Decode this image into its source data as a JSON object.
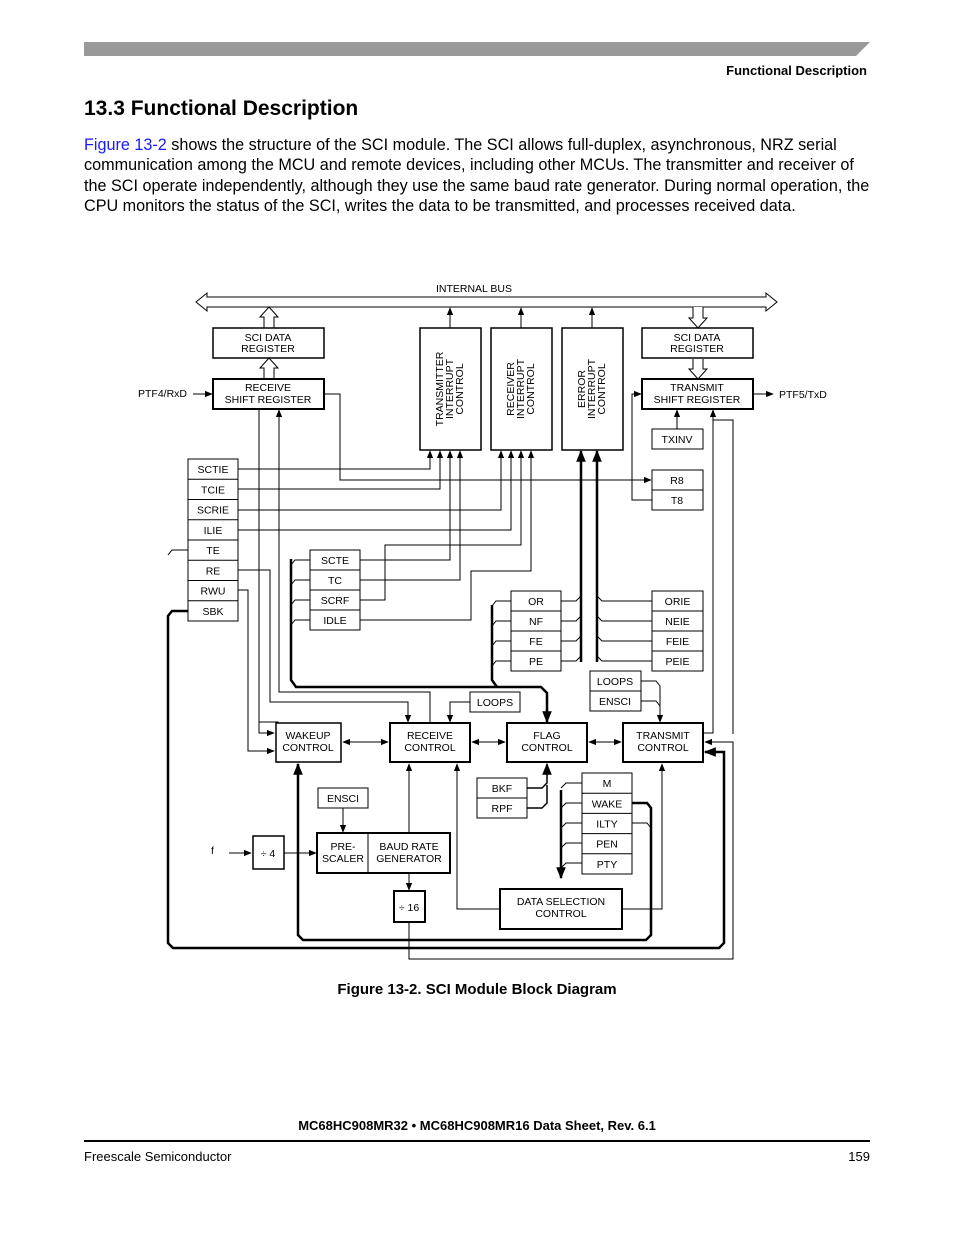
{
  "header": {
    "running_head": "Functional Description"
  },
  "section": {
    "title": "13.3  Functional Description",
    "paragraph_link": "Figure 13-2",
    "paragraph_rest": " shows the structure of the SCI module. The SCI allows full-duplex, asynchronous, NRZ serial communication among the MCU and remote devices, including other MCUs. The transmitter and receiver of the SCI operate independently, although they use the same baud rate generator. During normal operation, the CPU monitors the status of the SCI, writes the data to be transmitted, and processes received data."
  },
  "diagram": {
    "internal_bus": "INTERNAL BUS",
    "sci_data_register_rx": [
      "SCI DATA",
      "REGISTER"
    ],
    "sci_data_register_tx": [
      "SCI DATA",
      "REGISTER"
    ],
    "receive_shift_register": [
      "RECEIVE",
      "SHIFT REGISTER"
    ],
    "transmit_shift_register": [
      "TRANSMIT",
      "SHIFT REGISTER"
    ],
    "rxd_pin": "PTF4/RxD",
    "txd_pin": "PTF5/TxD",
    "transmitter_interrupt": [
      "TRANSMITTER",
      "INTERRUPT",
      "CONTROL"
    ],
    "receiver_interrupt": [
      "RECEIVER",
      "INTERRUPT",
      "CONTROL"
    ],
    "error_interrupt": [
      "ERROR",
      "INTERRUPT",
      "CONTROL"
    ],
    "txinv": "TXINV",
    "r8": "R8",
    "t8": "T8",
    "control_bits": [
      "SCTIE",
      "TCIE",
      "SCRIE",
      "ILIE",
      "TE",
      "RE",
      "RWU",
      "SBK"
    ],
    "status_bits": [
      "SCTE",
      "TC",
      "SCRF",
      "IDLE"
    ],
    "error_flags": [
      "OR",
      "NF",
      "FE",
      "PE"
    ],
    "error_enables": [
      "ORIE",
      "NEIE",
      "FEIE",
      "PEIE"
    ],
    "loops_rx": "LOOPS",
    "loops_tx": "LOOPS",
    "ensci_tx": "ENSCI",
    "ensci_prescaler": "ENSCI",
    "wakeup_control": [
      "WAKEUP",
      "CONTROL"
    ],
    "receive_control": [
      "RECEIVE",
      "CONTROL"
    ],
    "flag_control": [
      "FLAG",
      "CONTROL"
    ],
    "transmit_control": [
      "TRANSMIT",
      "CONTROL"
    ],
    "break_bits": [
      "BKF",
      "RPF"
    ],
    "format_bits": [
      "M",
      "WAKE",
      "ILTY",
      "PEN",
      "PTY"
    ],
    "clock_input": "f",
    "div4": "÷ 4",
    "prescaler": [
      "PRE-",
      "SCALER"
    ],
    "baud_rate_generator": [
      "BAUD RATE",
      "GENERATOR"
    ],
    "div16": "÷ 16",
    "data_selection_control": [
      "DATA SELECTION",
      "CONTROL"
    ]
  },
  "figure": {
    "caption": "Figure 13-2. SCI Module Block Diagram"
  },
  "footer": {
    "document_title": "MC68HC908MR32 • MC68HC908MR16 Data Sheet, Rev. 6.1",
    "company": "Freescale Semiconductor",
    "page_number": "159"
  },
  "colors": {
    "link": "#1a1aff",
    "top_bar": "#999999"
  }
}
